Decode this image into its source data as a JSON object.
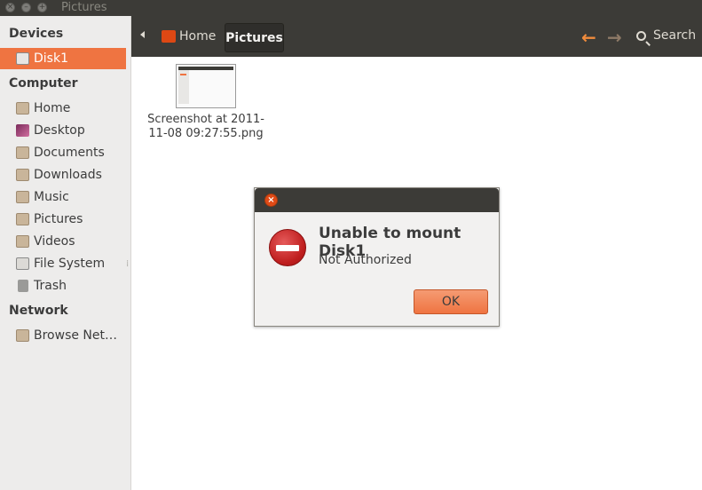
{
  "window": {
    "title": "Pictures"
  },
  "sidebar": {
    "sections": [
      {
        "header": "Devices",
        "items": [
          {
            "label": "Disk1",
            "icon": "drive-icon",
            "active": true
          }
        ]
      },
      {
        "header": "Computer",
        "items": [
          {
            "label": "Home",
            "icon": "home-folder-icon"
          },
          {
            "label": "Desktop",
            "icon": "desktop-icon"
          },
          {
            "label": "Documents",
            "icon": "documents-folder-icon"
          },
          {
            "label": "Downloads",
            "icon": "downloads-folder-icon"
          },
          {
            "label": "Music",
            "icon": "music-folder-icon"
          },
          {
            "label": "Pictures",
            "icon": "pictures-folder-icon"
          },
          {
            "label": "Videos",
            "icon": "videos-folder-icon"
          },
          {
            "label": "File System",
            "icon": "filesystem-icon"
          },
          {
            "label": "Trash",
            "icon": "trash-icon"
          }
        ]
      },
      {
        "header": "Network",
        "items": [
          {
            "label": "Browse Net…",
            "icon": "network-folder-icon"
          }
        ]
      }
    ]
  },
  "toolbar": {
    "breadcrumbs": [
      "Home",
      "Pictures"
    ],
    "search_label": "Search"
  },
  "files": [
    {
      "name": "Screenshot at 2011-11-08 09:27:55.png"
    }
  ],
  "dialog": {
    "heading": "Unable to mount Disk1",
    "message": "Not Authorized",
    "ok_label": "OK"
  },
  "colors": {
    "accent": "#ef7441",
    "dark_chrome": "#3c3b37",
    "error": "#c62828"
  }
}
